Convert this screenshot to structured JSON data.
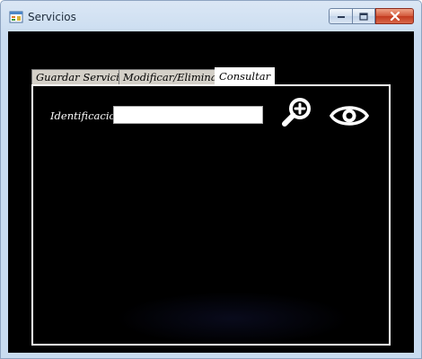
{
  "window": {
    "title": "Servicios",
    "app_icon": "windows-form-icon",
    "caption_buttons": {
      "minimize_icon": "minimize-icon",
      "maximize_icon": "maximize-icon",
      "close_icon": "close-icon"
    }
  },
  "tabs": [
    {
      "label": "Guardar Servicio",
      "active": false
    },
    {
      "label": "Modificar/Eliminar",
      "active": false
    },
    {
      "label": "Consultar",
      "active": true
    }
  ],
  "consultar": {
    "field_label": "Identificacion",
    "identificacion_value": "",
    "search_icon": "magnifier-plus-icon",
    "view_icon": "eye-icon"
  },
  "colors": {
    "client_background": "#000000",
    "panel_border": "#ffffff",
    "label_text": "#ffffff",
    "close_button": "#c2391d"
  }
}
